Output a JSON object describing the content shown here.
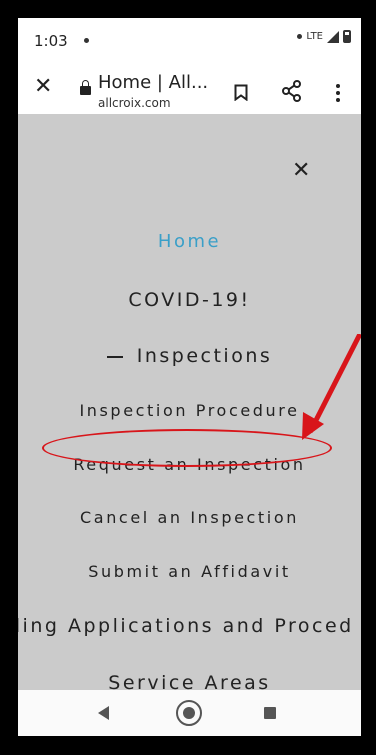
{
  "status": {
    "time": "1:03",
    "network": "LTE"
  },
  "toolbar": {
    "title": "Home | All...",
    "url": "allcroix.com"
  },
  "menu": {
    "items": [
      {
        "label": "Home"
      },
      {
        "label": "COVID-19!"
      },
      {
        "label": "Inspections"
      },
      {
        "label": "Inspection Procedure"
      },
      {
        "label": "Request an Inspection"
      },
      {
        "label": "Cancel an Inspection"
      },
      {
        "label": "Submit an Affidavit"
      },
      {
        "label": "ding Applications and Proced"
      },
      {
        "label": "Service Areas"
      }
    ]
  },
  "colors": {
    "accent_link": "#3a9fc8",
    "annotation_red": "#d8151a",
    "menu_background": "#cbcbcb"
  },
  "icons": [
    "close-icon",
    "lock-icon",
    "bookmark-icon",
    "share-icon",
    "more-vert-icon",
    "menu-close-icon",
    "collapse-dash-icon",
    "back-icon",
    "home-icon",
    "recents-icon"
  ]
}
